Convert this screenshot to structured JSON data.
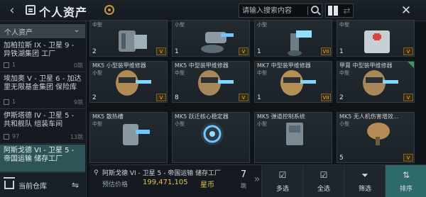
{
  "header": {
    "title": "个人资产",
    "search_placeholder": "请输入搜索内容",
    "close": "✕"
  },
  "sidebar": {
    "header_label": "个人资产",
    "locations": [
      {
        "name": "加柏拉斯 IX - 卫星 9 - 异铁湖集团 工厂",
        "count": "1",
        "jumps": "0跳"
      },
      {
        "name": "埃加奥 V - 卫星 6 - 加达里无限基金集团 保险库",
        "count": "1",
        "jumps": "9跳"
      },
      {
        "name": "伊斯塔德 IV - 卫星 5 - 共和舰队 组装车间",
        "count": "97",
        "jumps": "13跳"
      },
      {
        "name": "阿斯戈德 VI - 卫星 5 - 帝国运输 储存工厂",
        "count": "",
        "jumps": ""
      }
    ],
    "current_label": "当前仓库"
  },
  "items": [
    {
      "name": "",
      "size": "中型",
      "qty": "2",
      "tier": "V"
    },
    {
      "name": "",
      "size": "小型",
      "qty": "1",
      "tier": "V"
    },
    {
      "name": "",
      "size": "小型",
      "qty": "1",
      "tier": "VII"
    },
    {
      "name": "",
      "size": "中型",
      "qty": "1",
      "tier": "V"
    },
    {
      "name": "MK5 小型装甲维修器",
      "size": "小型",
      "qty": "2",
      "tier": "V"
    },
    {
      "name": "MK5 中型装甲维修器",
      "size": "中型",
      "qty": "8",
      "tier": "V"
    },
    {
      "name": "MK7 中型装甲维修器",
      "size": "中型",
      "qty": "1",
      "tier": "VII"
    },
    {
      "name": "甲胄 中型装甲维修器",
      "size": "中型",
      "qty": "2",
      "tier": "V"
    },
    {
      "name": "MK5 散热槽",
      "size": "中型",
      "qty": "",
      "tier": ""
    },
    {
      "name": "MK5 跃迁核心稳定器",
      "size": "小型",
      "qty": "",
      "tier": ""
    },
    {
      "name": "MK5 弹道控制系统",
      "size": "小型",
      "qty": "",
      "tier": ""
    },
    {
      "name": "MK5 无人机伤害增效...",
      "size": "小型",
      "qty": "5",
      "tier": "V"
    }
  ],
  "footer": {
    "location": "阿斯戈德 VI - 卫星 5 - 帝国运输 储存工厂",
    "price_label": "预估价格",
    "price_value": "199,471,105",
    "currency": "星币",
    "jumps": "7",
    "jumps_unit": "跳",
    "actions": [
      "多选",
      "全选",
      "筛选",
      "排序"
    ]
  },
  "colors": {
    "accent": "#2f6a6a",
    "gold": "#e4c155",
    "selected": "#2e5457"
  }
}
